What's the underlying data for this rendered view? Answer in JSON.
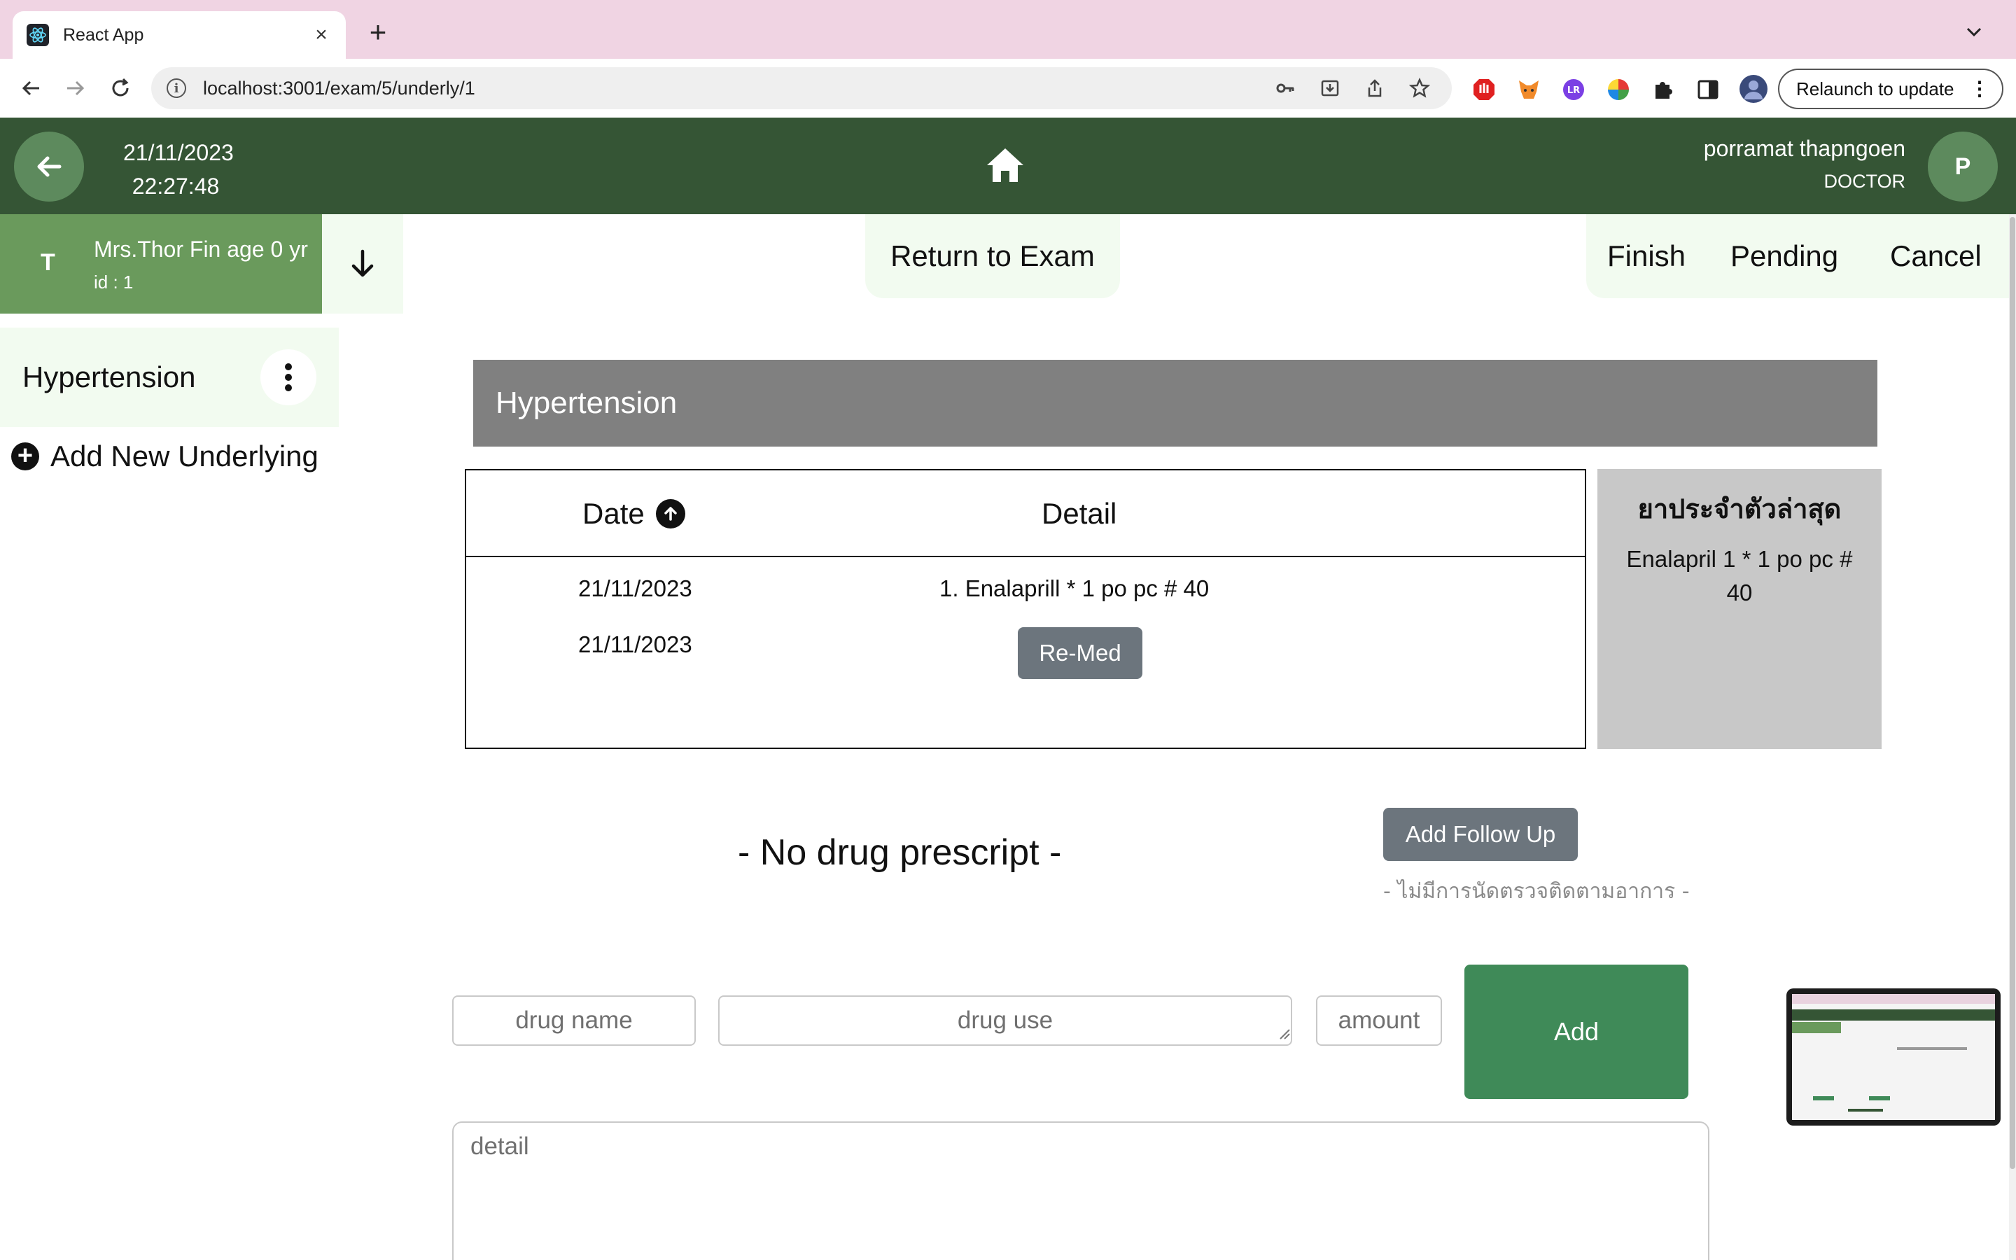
{
  "browser": {
    "tab_title": "React App",
    "url": "localhost:3001/exam/5/underly/1",
    "relaunch_label": "Relaunch to update"
  },
  "header": {
    "date": "21/11/2023",
    "time": "22:27:48",
    "user_name": "porramat thapngoen",
    "user_role": "DOCTOR",
    "avatar_initial": "P"
  },
  "patient": {
    "initial": "T",
    "name": "Mrs.Thor Fin age 0 yr",
    "id": "id : 1"
  },
  "actions": {
    "return_label": "Return to Exam",
    "finish_label": "Finish",
    "pending_label": "Pending",
    "cancel_label": "Cancel"
  },
  "sidebar": {
    "items": [
      {
        "label": "Hypertension"
      }
    ],
    "add_label": "Add New Underlying"
  },
  "main": {
    "title": "Hypertension",
    "table": {
      "columns": [
        "Date",
        "Detail"
      ],
      "rows": [
        {
          "date": "21/11/2023",
          "detail": "1. Enalaprill * 1 po pc # 40"
        },
        {
          "date": "21/11/2023",
          "detail": ""
        }
      ],
      "remed_label": "Re-Med"
    },
    "latest_med": {
      "title": "ยาประจำตัวล่าสุด",
      "body": "Enalapril 1 * 1 po pc # 40"
    },
    "no_drug": "- No drug prescript -",
    "follow_up_label": "Add Follow Up",
    "no_follow_up": "- ไม่มีการนัดตรวจติดตามอาการ -",
    "form": {
      "drug_name_placeholder": "drug name",
      "drug_use_placeholder": "drug use",
      "amount_placeholder": "amount",
      "add_label": "Add",
      "detail_placeholder": "detail"
    }
  },
  "colors": {
    "header_bg": "#355535",
    "patient_bg": "#6a9a5c",
    "accent_light": "#f2fbf0",
    "add_button": "#3f8a58",
    "section_header": "#808080"
  }
}
